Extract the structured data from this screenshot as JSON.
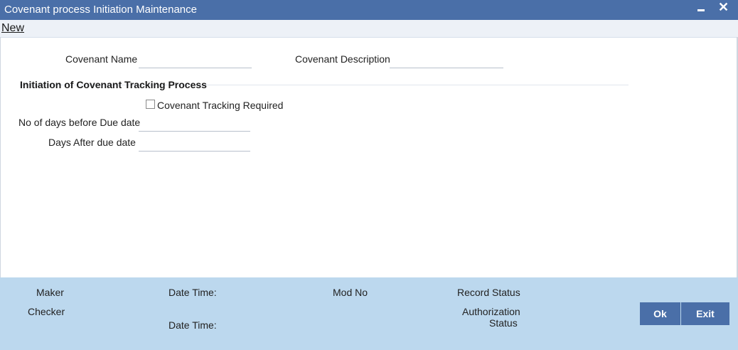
{
  "window": {
    "title": "Covenant process Initiation Maintenance",
    "minimize_icon": "minimize-icon",
    "close_icon": "close-icon",
    "close_glyph": "✕"
  },
  "menu": {
    "new_label": "New"
  },
  "form": {
    "covenant_name_label": "Covenant Name",
    "covenant_name_value": "",
    "covenant_description_label": "Covenant Description",
    "covenant_description_value": "",
    "section_title": "Initiation of Covenant Tracking Process",
    "tracking_required_label": "Covenant Tracking Required",
    "tracking_required_checked": false,
    "days_before_label": "No of days before Due date",
    "days_before_value": "",
    "days_after_label": "Days After due date",
    "days_after_value": ""
  },
  "footer": {
    "maker_label": "Maker",
    "checker_label": "Checker",
    "date_time_label_1": "Date Time:",
    "date_time_label_2": "Date Time:",
    "mod_no_label": "Mod No",
    "record_status_label": "Record Status",
    "authorization_label_1": "Authorization",
    "authorization_label_2": "Status",
    "ok_label": "Ok",
    "exit_label": "Exit"
  },
  "colors": {
    "titlebar": "#4a6fa8",
    "footer": "#bcd8ee",
    "button": "#4a6fa8"
  }
}
